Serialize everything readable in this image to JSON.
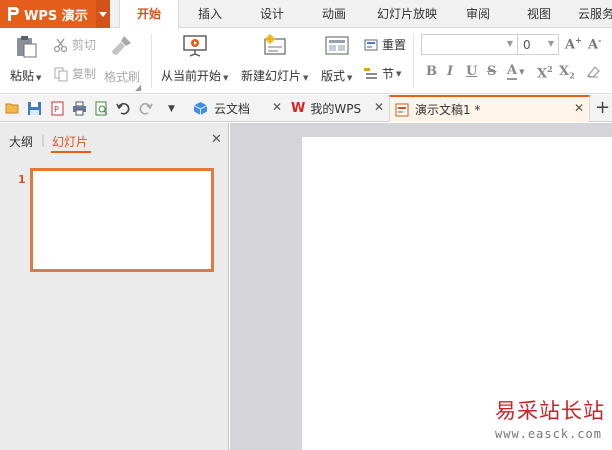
{
  "app": {
    "title": "WPS 演示",
    "accent_color": "#e55e1b",
    "drop_icon": "chevron-down-icon"
  },
  "menu_tabs": [
    "开始",
    "插入",
    "设计",
    "动画",
    "幻灯片放映",
    "审阅",
    "视图",
    "云服务"
  ],
  "active_menu_tab": "开始",
  "ribbon": {
    "paste": "粘贴",
    "cut": "剪切",
    "copy": "复制",
    "format_painter": "格式刷",
    "from_current": "从当前开始",
    "new_slide": "新建幻灯片",
    "layout": "版式",
    "reset": "重置",
    "section": "节",
    "font_size_value": "0",
    "font_name_value": ""
  },
  "doc_tabs": [
    {
      "label": "云文档",
      "icon": "cloud-cube-icon"
    },
    {
      "label": "我的WPS",
      "icon": "wps-w-icon"
    },
    {
      "label": "演示文稿1 *",
      "icon": "presentation-icon",
      "active": true
    }
  ],
  "new_tab_icon": "plus-icon",
  "left_pane": {
    "tabs": [
      "大纲",
      "幻灯片"
    ],
    "active_tab": "幻灯片",
    "slides": [
      {
        "number": "1"
      }
    ]
  },
  "watermark": {
    "text": "易采站长站",
    "url": "www.easck.com"
  }
}
